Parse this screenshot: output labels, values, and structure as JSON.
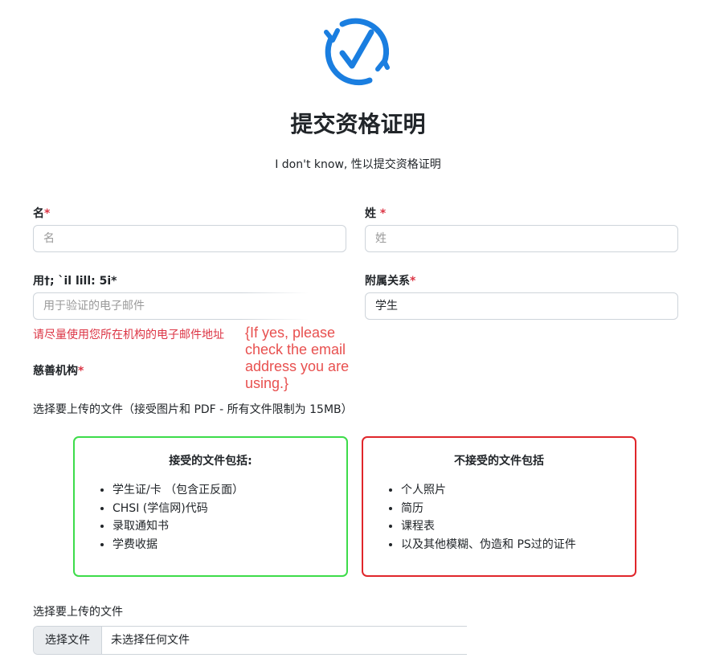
{
  "header": {
    "title": "提交资格证明",
    "subtitle": "I don't know, 性以提交资格证明"
  },
  "form": {
    "first_name": {
      "label": "名",
      "required_mark": "*",
      "placeholder": "名"
    },
    "last_name": {
      "label": "姓",
      "required_mark": "*",
      "placeholder": "姓"
    },
    "email": {
      "label": "用†; `il lill: 5i",
      "required_mark": "*",
      "placeholder": "用于验证的电子邮件",
      "help": "请尽量使用您所在机构的电子邮件地址"
    },
    "affiliation": {
      "label": "附属关系",
      "required_mark": "*",
      "value": "学生"
    },
    "charity": {
      "label": "慈善机构",
      "required_mark": "*"
    },
    "file_description": "选择要上传的文件（接受图片和 PDF - 所有文件限制为 15MB）"
  },
  "annotation": "{If yes, please\ncheck the email\naddress you are\nusing.}",
  "accepted": {
    "title": "接受的文件包括:",
    "items": [
      "学生证/卡 （包含正反面）",
      "CHSI (学信网)代码",
      "录取通知书",
      "学费收据"
    ],
    "border_color": "#3ddc4a"
  },
  "rejected": {
    "title": "不接受的文件包括",
    "items": [
      "个人照片",
      "简历",
      "课程表",
      "以及其他模糊、伪造和 PS过的证件"
    ],
    "border_color": "#e0262b"
  },
  "upload": {
    "label": "选择要上传的文件",
    "button": "选择文件",
    "status": "未选择任何文件"
  },
  "colors": {
    "accent": "#1a7ee0",
    "required": "#dc3545",
    "annotation": "#e8504f"
  },
  "icons": {
    "logo": "check-circle-refresh-icon"
  }
}
